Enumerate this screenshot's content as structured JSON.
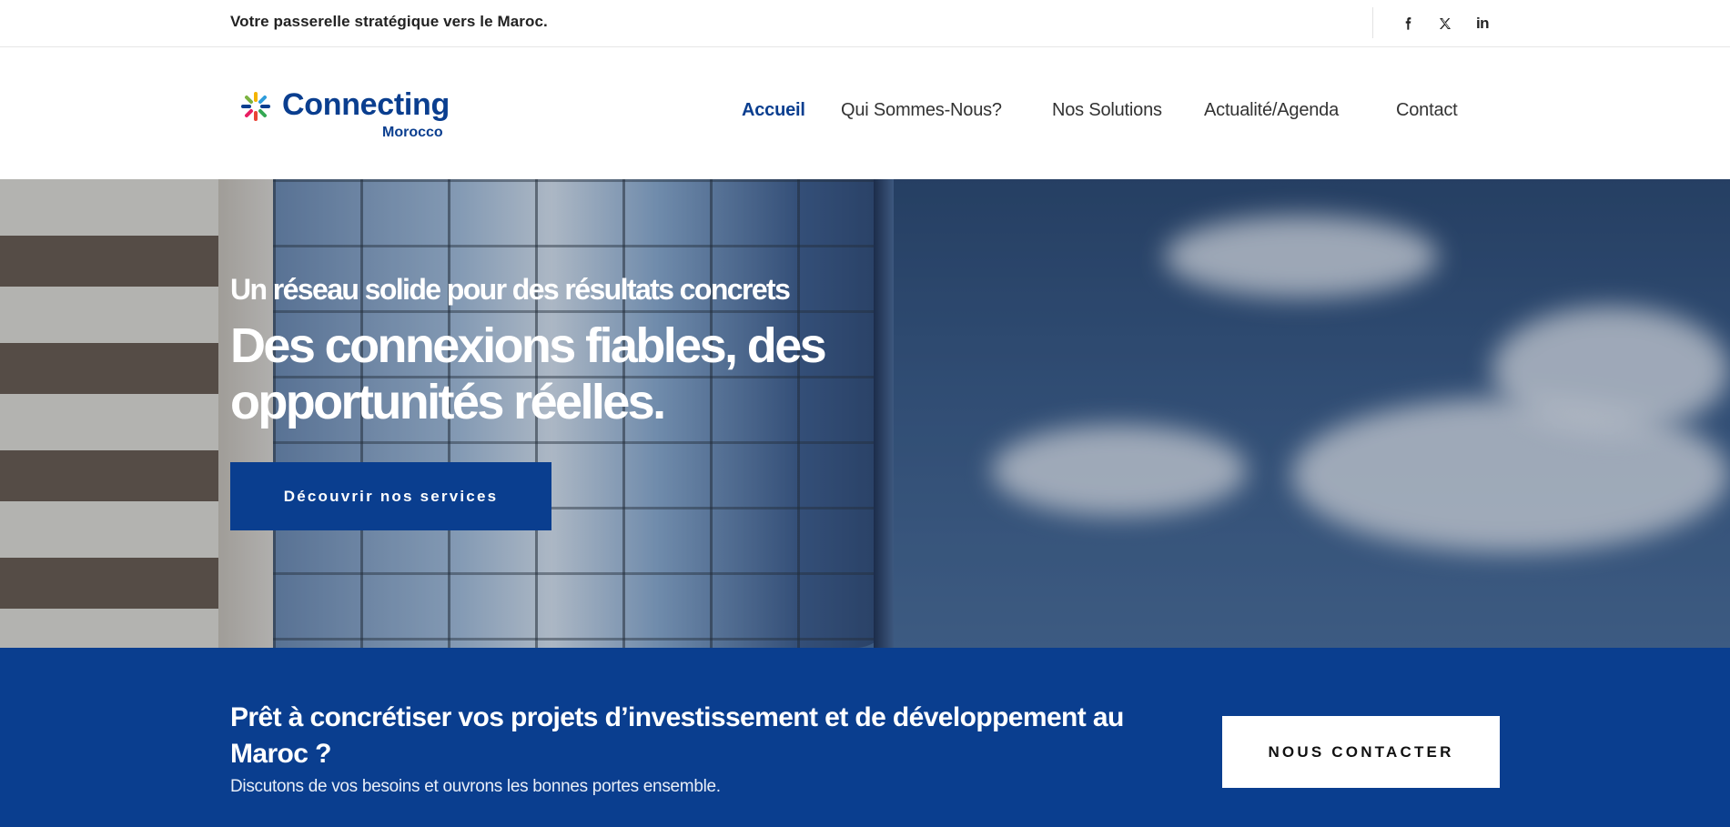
{
  "topbar": {
    "tagline": "Votre passerelle stratégique vers le Maroc.",
    "social": [
      {
        "name": "facebook-icon"
      },
      {
        "name": "x-twitter-icon"
      },
      {
        "name": "linkedin-icon",
        "text": "in"
      }
    ]
  },
  "header": {
    "logo": {
      "brand": "Connecting",
      "sub": "Morocco"
    },
    "nav": [
      {
        "label": "Accueil",
        "active": true
      },
      {
        "label": "Qui Sommes-Nous?"
      },
      {
        "label": "Nos Solutions"
      },
      {
        "label": "Actualité/Agenda"
      },
      {
        "label": "Contact"
      }
    ]
  },
  "hero": {
    "kicker": "Un réseau solide pour des résultats concrets",
    "headline": "Des connexions fiables, des opportunités réelles.",
    "cta_label": "Découvrir nos services"
  },
  "band": {
    "question": "Prêt à concrétiser vos projets d’investissement et de développement au Maroc ?",
    "subtitle": "Discutons de vos besoins et ouvrons les bonnes portes ensemble.",
    "button_label": "NOUS CONTACTER"
  },
  "colors": {
    "brand_blue": "#0a3e8f",
    "text_dark": "#222222",
    "white": "#ffffff"
  }
}
